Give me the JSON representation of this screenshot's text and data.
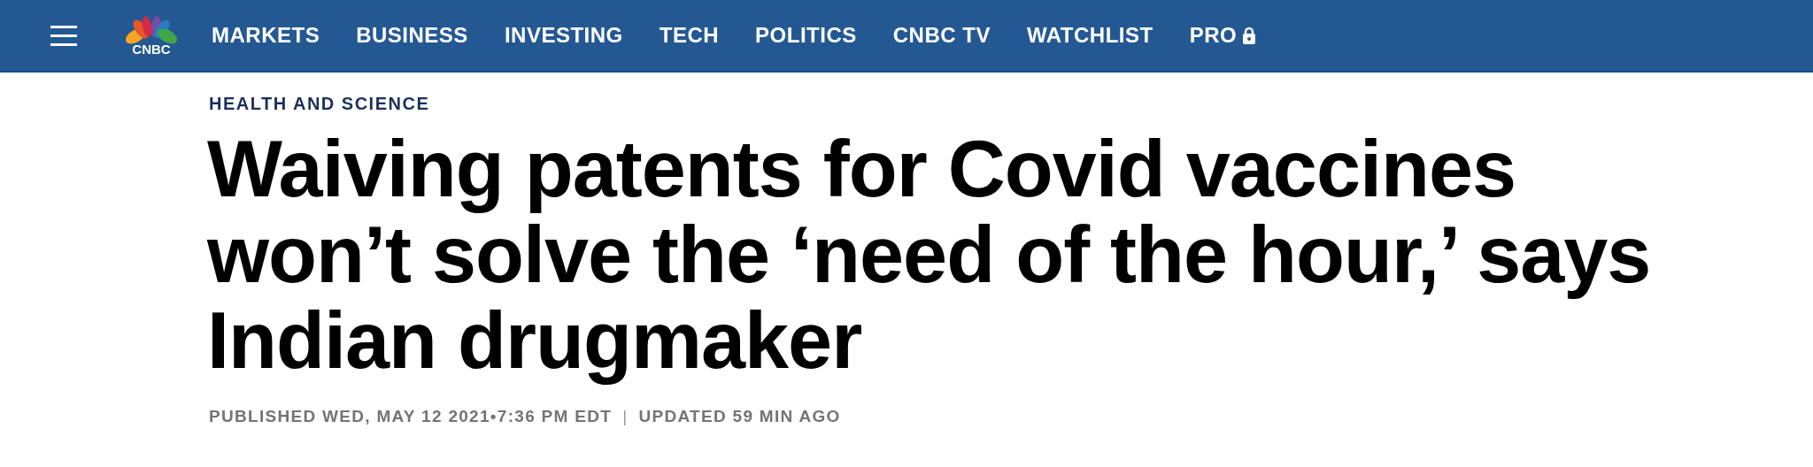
{
  "nav": {
    "logo_text": "CNBC",
    "items": [
      {
        "label": "MARKETS",
        "locked": false
      },
      {
        "label": "BUSINESS",
        "locked": false
      },
      {
        "label": "INVESTING",
        "locked": false
      },
      {
        "label": "TECH",
        "locked": false
      },
      {
        "label": "POLITICS",
        "locked": false
      },
      {
        "label": "CNBC TV",
        "locked": false
      },
      {
        "label": "WATCHLIST",
        "locked": false
      },
      {
        "label": "PRO",
        "locked": true
      }
    ]
  },
  "article": {
    "category": "HEALTH AND SCIENCE",
    "headline": "Waiving patents for Covid vaccines won’t solve the ‘need of the hour,’ says Indian drugmaker",
    "published": "PUBLISHED WED, MAY 12 2021•7:36 PM EDT",
    "separator": "|",
    "updated": "UPDATED 59 MIN AGO"
  }
}
